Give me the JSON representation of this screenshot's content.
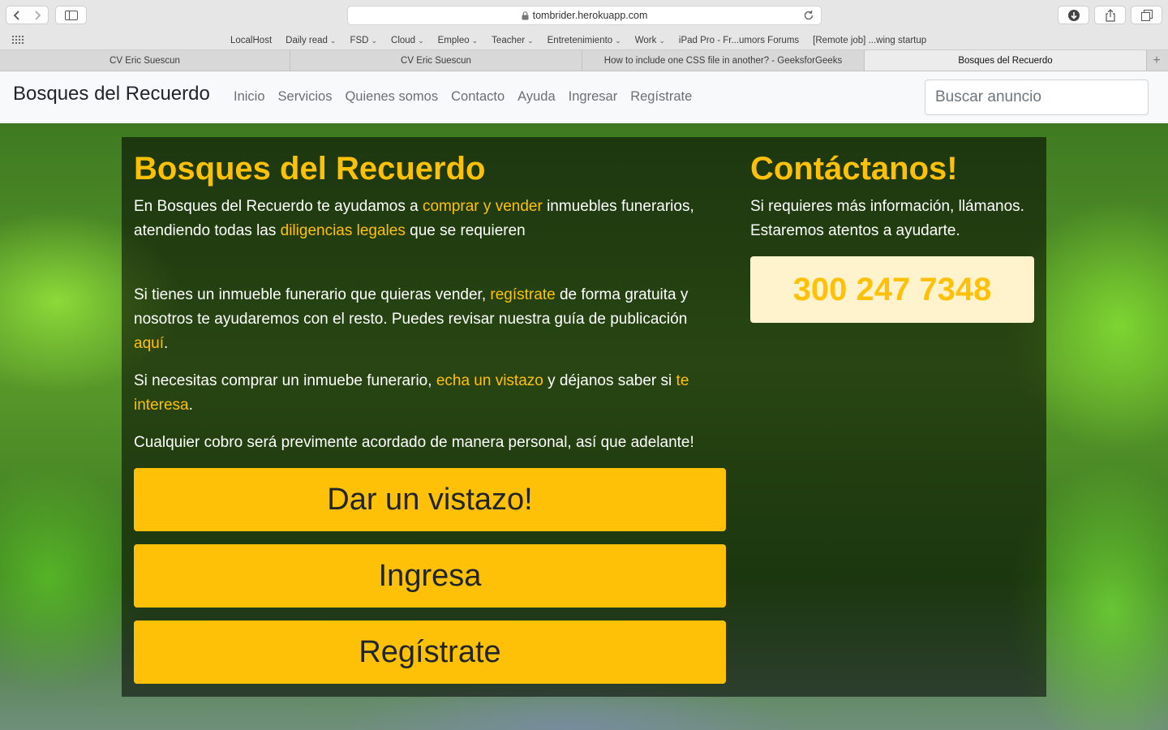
{
  "browser": {
    "address": "tombrider.herokuapp.com",
    "bookmarks": [
      {
        "label": "LocalHost",
        "menu": false
      },
      {
        "label": "Daily read",
        "menu": true
      },
      {
        "label": "FSD",
        "menu": true
      },
      {
        "label": "Cloud",
        "menu": true
      },
      {
        "label": "Empleo",
        "menu": true
      },
      {
        "label": "Teacher",
        "menu": true
      },
      {
        "label": "Entretenimiento",
        "menu": true
      },
      {
        "label": "Work",
        "menu": true
      },
      {
        "label": "iPad Pro - Fr...umors Forums",
        "menu": false
      },
      {
        "label": "[Remote job] ...wing startup",
        "menu": false
      }
    ],
    "tabs": [
      {
        "label": "CV Eric Suescun",
        "active": false
      },
      {
        "label": "CV Eric Suescun",
        "active": false
      },
      {
        "label": "How to include one CSS file in another? - GeeksforGeeks",
        "active": false
      },
      {
        "label": "Bosques del Recuerdo",
        "active": true
      }
    ]
  },
  "navbar": {
    "brand": "Bosques del Recuerdo",
    "links": [
      "Inicio",
      "Servicios",
      "Quienes somos",
      "Contacto",
      "Ayuda",
      "Ingresar",
      "Regístrate"
    ],
    "search_placeholder": "Buscar anuncio"
  },
  "main": {
    "title": "Bosques del Recuerdo",
    "intro": {
      "t1": "En Bosques del Recuerdo te ayudamos a ",
      "h1": "comprar y vender",
      "t2": " inmuebles funerarios, atendiendo todas las ",
      "h2": "diligencias legales",
      "t3": " que se requieren"
    },
    "sell": {
      "t1": "Si tienes un inmueble funerario que quieras vender, ",
      "h1": "regístrate",
      "t2": " de forma gratuita y nosotros te ayudaremos con el resto. Puedes revisar nuestra guía de publicación ",
      "h2": "aquí",
      "t3": "."
    },
    "buy": {
      "t1": "Si necesitas comprar un inmuebe funerario, ",
      "h1": "echa un vistazo",
      "t2": " y déjanos saber si ",
      "h2": "te interesa",
      "t3": "."
    },
    "charges": "Cualquier cobro será previmente acordado de manera personal, así que adelante!",
    "buttons": [
      "Dar un vistazo!",
      "Ingresa",
      "Regístrate"
    ]
  },
  "contact": {
    "title": "Contáctanos!",
    "text": "Si requieres más información, llámanos. Estaremos atentos a ayudarte.",
    "phone": "300 247 7348"
  },
  "colors": {
    "accent": "#ffc107",
    "phone_bg": "#fff3cd",
    "navbar_bg": "#f8f9fa"
  }
}
